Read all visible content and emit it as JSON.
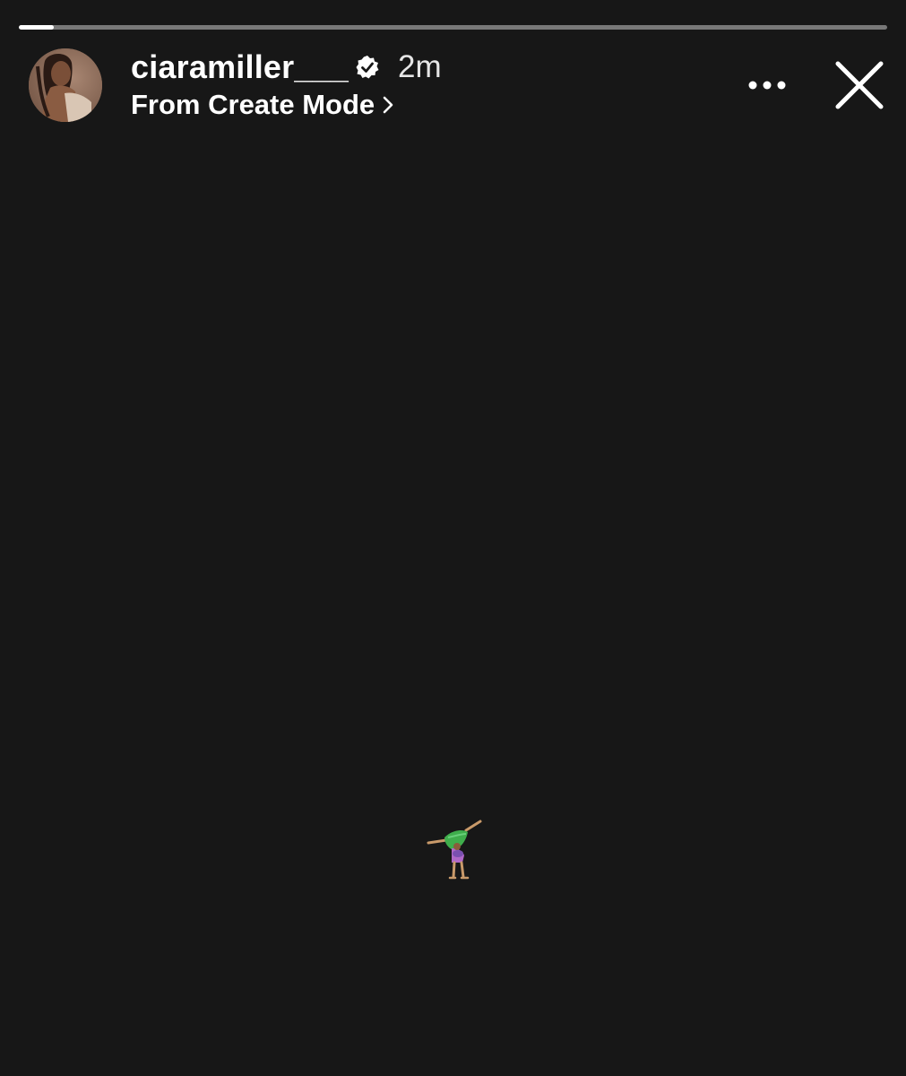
{
  "story": {
    "progress_fraction": 0.04,
    "colors": {
      "background": "#171717",
      "text": "#ffffff",
      "progress_track": "rgba(255,255,255,0.42)",
      "progress_fill": "#ffffff"
    }
  },
  "header": {
    "avatar_icon": "profile-photo",
    "username": "ciaramiller___",
    "verified_icon": "verified-badge-icon",
    "time_ago": "2m",
    "subtitle": "From Create Mode",
    "subtitle_icon": "chevron-right-icon",
    "more_icon": "more-horizontal-icon",
    "close_icon": "close-icon"
  },
  "content": {
    "sticker_icon": "cartwheel-emoji"
  }
}
